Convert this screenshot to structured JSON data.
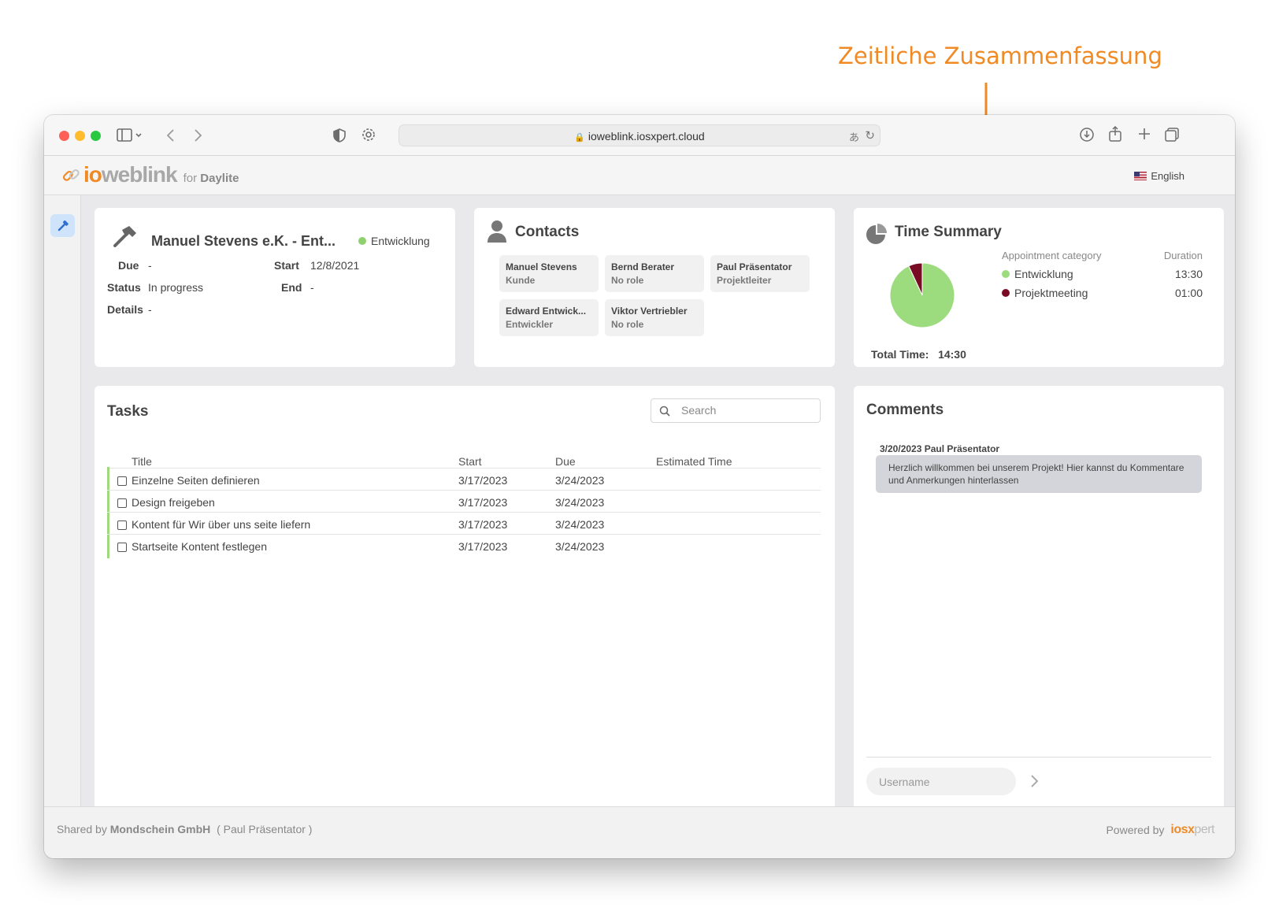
{
  "annotation": {
    "text": "Zeitliche Zusammenfassung"
  },
  "browser": {
    "url": "ioweblink.iosxpert.cloud"
  },
  "header": {
    "logo_io": "io",
    "logo_web": "weblink",
    "for_text": "for",
    "for_app": "Daylite",
    "language": "English"
  },
  "project": {
    "title": "Manuel Stevens e.K. - Ent...",
    "badge": "Entwicklung",
    "badge_color": "#8fd16d",
    "fields": {
      "due_label": "Due",
      "due_value": "-",
      "start_label": "Start",
      "start_value": "12/8/2021",
      "status_label": "Status",
      "status_value": "In progress",
      "end_label": "End",
      "end_value": "-",
      "details_label": "Details",
      "details_value": "-"
    }
  },
  "contacts": {
    "title": "Contacts",
    "items": [
      {
        "name": "Manuel Stevens",
        "role": "Kunde"
      },
      {
        "name": "Bernd Berater",
        "role": "No role"
      },
      {
        "name": "Paul Präsentator",
        "role": "Projektleiter"
      },
      {
        "name": "Edward Entwick...",
        "role": "Entwickler"
      },
      {
        "name": "Viktor Vertriebler",
        "role": "No role"
      }
    ]
  },
  "time_summary": {
    "title": "Time Summary",
    "col_category": "Appointment category",
    "col_duration": "Duration",
    "rows": [
      {
        "category": "Entwicklung",
        "duration": "13:30",
        "color": "#9ddc7e",
        "minutes": 810
      },
      {
        "category": "Projektmeeting",
        "duration": "01:00",
        "color": "#7a0b24",
        "minutes": 60
      }
    ],
    "total_label": "Total Time:",
    "total_value": "14:30"
  },
  "tasks": {
    "title": "Tasks",
    "search_placeholder": "Search",
    "columns": {
      "title": "Title",
      "start": "Start",
      "due": "Due",
      "estimated": "Estimated Time"
    },
    "rows": [
      {
        "title": "Einzelne Seiten definieren",
        "start": "3/17/2023",
        "due": "3/24/2023",
        "estimated": ""
      },
      {
        "title": "Design freigeben",
        "start": "3/17/2023",
        "due": "3/24/2023",
        "estimated": ""
      },
      {
        "title": "Kontent für Wir über uns seite liefern",
        "start": "3/17/2023",
        "due": "3/24/2023",
        "estimated": ""
      },
      {
        "title": "Startseite Kontent festlegen",
        "start": "3/17/2023",
        "due": "3/24/2023",
        "estimated": ""
      }
    ]
  },
  "comments": {
    "title": "Comments",
    "items": [
      {
        "meta": "3/20/2023 Paul Präsentator",
        "text": "Herzlich willkommen bei unserem Projekt! Hier kannst du Kommentare und Anmerkungen hinterlassen"
      }
    ],
    "username_placeholder": "Username"
  },
  "footer": {
    "shared_by_label": "Shared by",
    "shared_by_org": "Mondschein GmbH",
    "shared_by_person": "( Paul Präsentator )",
    "powered_by_label": "Powered by",
    "powered_brand_a": "iosx",
    "powered_brand_b": "pert"
  }
}
